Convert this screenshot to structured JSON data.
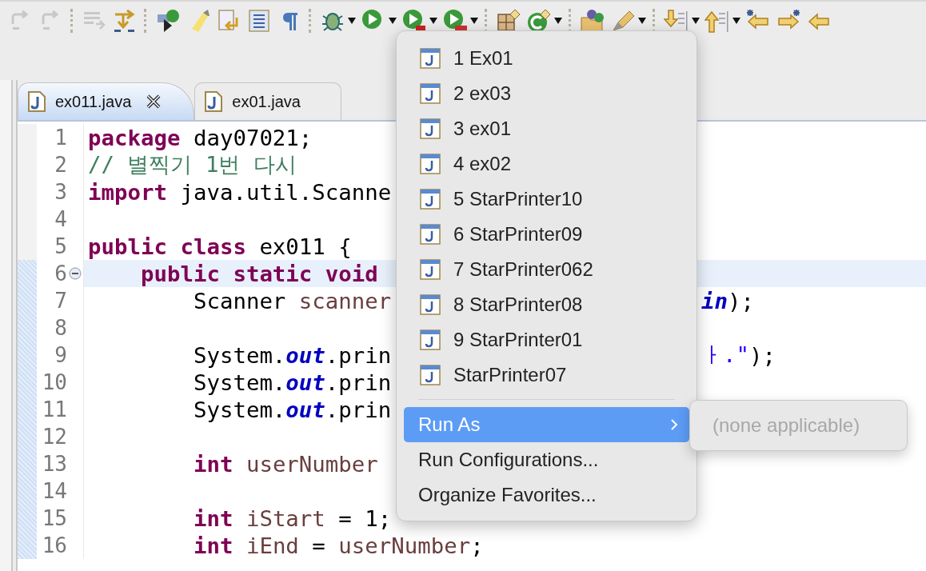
{
  "editor_tabs": [
    {
      "label": "ex011.java",
      "selected": true
    },
    {
      "label": "ex01.java",
      "selected": false
    }
  ],
  "code_lines": [
    {
      "number": "1",
      "current": false,
      "scope": false,
      "foldable": false,
      "segments": [
        {
          "kind": "keyword",
          "text": "package"
        },
        {
          "kind": "plain",
          "text": " day07021;"
        }
      ]
    },
    {
      "number": "2",
      "current": false,
      "scope": false,
      "foldable": false,
      "segments": [
        {
          "kind": "comment",
          "text": "// 별찍기 1번 다시"
        }
      ]
    },
    {
      "number": "3",
      "current": false,
      "scope": false,
      "foldable": false,
      "segments": [
        {
          "kind": "keyword",
          "text": "import"
        },
        {
          "kind": "plain",
          "text": " java.util.Scanne"
        }
      ]
    },
    {
      "number": "4",
      "current": false,
      "scope": false,
      "foldable": false
    },
    {
      "number": "5",
      "current": false,
      "scope": false,
      "foldable": false,
      "segments": [
        {
          "kind": "keyword",
          "text": "public class"
        },
        {
          "kind": "plain",
          "text": " ex011 {"
        }
      ]
    },
    {
      "number": "6",
      "current": true,
      "scope": true,
      "foldable": true,
      "segments": [
        {
          "kind": "keyword",
          "text": "    public static void"
        }
      ]
    },
    {
      "number": "7",
      "current": false,
      "scope": true,
      "foldable": false,
      "segments": [
        {
          "kind": "plain",
          "text": "        Scanner "
        },
        {
          "kind": "variable",
          "text": "scanner"
        }
      ],
      "tail": [
        {
          "kind": "field",
          "text": "in"
        },
        {
          "kind": "plain",
          "text": ");"
        }
      ]
    },
    {
      "number": "8",
      "current": false,
      "scope": true,
      "foldable": false
    },
    {
      "number": "9",
      "current": false,
      "scope": true,
      "foldable": false,
      "segments": [
        {
          "kind": "plain",
          "text": "        System."
        },
        {
          "kind": "field",
          "text": "out"
        },
        {
          "kind": "plain",
          "text": ".prin"
        }
      ],
      "tail": [
        {
          "kind": "string",
          "text": "ㅏ.\""
        },
        {
          "kind": "plain",
          "text": ");"
        }
      ]
    },
    {
      "number": "10",
      "current": false,
      "scope": true,
      "foldable": false,
      "segments": [
        {
          "kind": "plain",
          "text": "        System."
        },
        {
          "kind": "field",
          "text": "out"
        },
        {
          "kind": "plain",
          "text": ".prin"
        }
      ]
    },
    {
      "number": "11",
      "current": false,
      "scope": true,
      "foldable": false,
      "segments": [
        {
          "kind": "plain",
          "text": "        System."
        },
        {
          "kind": "field",
          "text": "out"
        },
        {
          "kind": "plain",
          "text": ".prin"
        }
      ]
    },
    {
      "number": "12",
      "current": false,
      "scope": true,
      "foldable": false
    },
    {
      "number": "13",
      "current": false,
      "scope": true,
      "foldable": false,
      "segments": [
        {
          "kind": "keyword",
          "text": "        int"
        },
        {
          "kind": "variable",
          "text": " userNumber"
        }
      ]
    },
    {
      "number": "14",
      "current": false,
      "scope": true,
      "foldable": false
    },
    {
      "number": "15",
      "current": false,
      "scope": true,
      "foldable": false,
      "segments": [
        {
          "kind": "keyword",
          "text": "        int"
        },
        {
          "kind": "variable",
          "text": " iStart"
        },
        {
          "kind": "plain",
          "text": " = 1;"
        }
      ]
    },
    {
      "number": "16",
      "current": false,
      "scope": true,
      "foldable": false,
      "segments": [
        {
          "kind": "keyword",
          "text": "        int"
        },
        {
          "kind": "variable",
          "text": " iEnd"
        },
        {
          "kind": "plain",
          "text": " = "
        },
        {
          "kind": "variable",
          "text": "userNumber"
        },
        {
          "kind": "plain",
          "text": ";"
        }
      ]
    }
  ],
  "run_menu": {
    "history": [
      {
        "label": "1 Ex01",
        "selected": false
      },
      {
        "label": "2 ex03",
        "selected": false
      },
      {
        "label": "3 ex01",
        "selected": false
      },
      {
        "label": "4 ex02",
        "selected": false
      },
      {
        "label": "5 StarPrinter10",
        "selected": false
      },
      {
        "label": "6 StarPrinter09",
        "selected": false
      },
      {
        "label": "7 StarPrinter062",
        "selected": false
      },
      {
        "label": "8 StarPrinter08",
        "selected": false
      },
      {
        "label": "9 StarPrinter01",
        "selected": false
      },
      {
        "label": "StarPrinter07",
        "selected": false
      }
    ],
    "items": [
      {
        "label": "Run As",
        "selected": true,
        "submenu": true
      },
      {
        "label": "Run Configurations...",
        "selected": false,
        "submenu": false
      },
      {
        "label": "Organize Favorites...",
        "selected": false,
        "submenu": false
      }
    ],
    "submenu_items": [
      {
        "label": "(none applicable)",
        "disabled": true
      }
    ]
  }
}
